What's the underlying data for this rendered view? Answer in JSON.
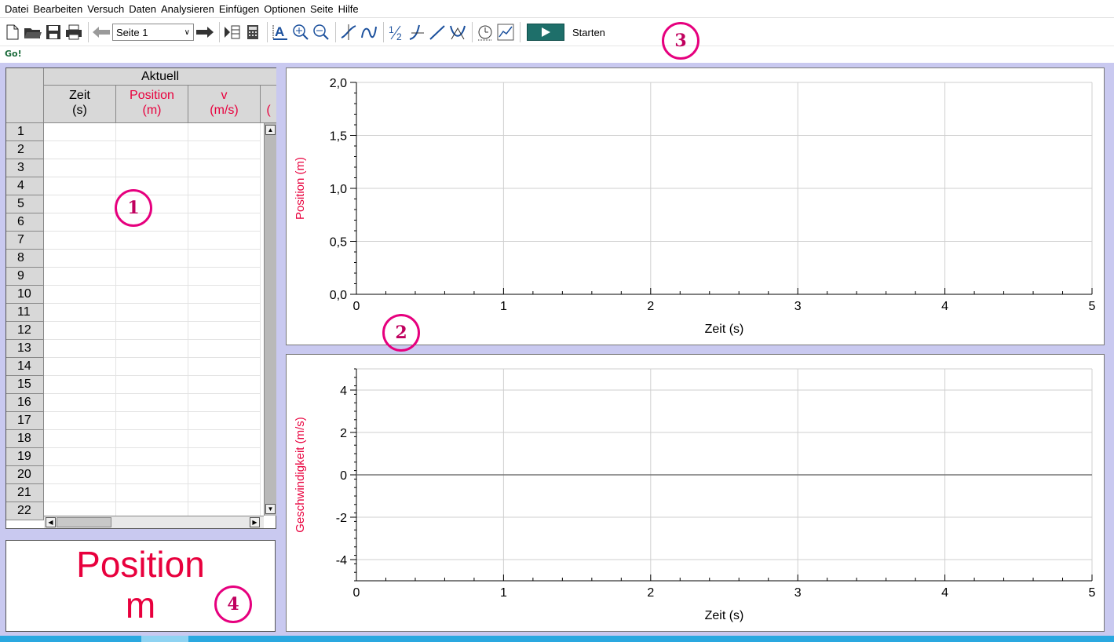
{
  "menu": [
    "Datei",
    "Bearbeiten",
    "Versuch",
    "Daten",
    "Analysieren",
    "Einfügen",
    "Optionen",
    "Seite",
    "Hilfe"
  ],
  "toolbar": {
    "page_select": "Seite 1",
    "start_label": "Starten",
    "icons": [
      "new-file-icon",
      "open-folder-icon",
      "save-icon",
      "print-icon",
      "back-arrow-icon",
      "forward-arrow-icon",
      "next-page-icon",
      "calculator-icon",
      "autoscale-icon",
      "zoom-in-icon",
      "zoom-out-icon",
      "examine-icon",
      "interpolate-icon",
      "half-fraction-icon",
      "tangent-icon",
      "linear-fit-icon",
      "curve-fit-icon",
      "stopwatch-icon",
      "graph-options-icon",
      "play-icon"
    ]
  },
  "go_logo": "Go!",
  "table": {
    "group_header": "Aktuell",
    "columns": [
      {
        "name": "Zeit",
        "unit": "(s)",
        "color": "#000000"
      },
      {
        "name": "Position",
        "unit": "(m)",
        "color": "#e8003d"
      },
      {
        "name": "v",
        "unit": "(m/s)",
        "color": "#e8003d"
      }
    ],
    "partial_column": "(",
    "rows": [
      "1",
      "2",
      "3",
      "4",
      "5",
      "6",
      "7",
      "8",
      "9",
      "10",
      "11",
      "12",
      "13",
      "14",
      "15",
      "16",
      "17",
      "18",
      "19",
      "20",
      "21",
      "22"
    ]
  },
  "meter": {
    "label": "Position",
    "unit": "m",
    "color": "#e8003d"
  },
  "callouts": [
    "1",
    "2",
    "3",
    "4"
  ],
  "chart_data": [
    {
      "type": "line",
      "title": "",
      "xlabel": "Zeit (s)",
      "ylabel": "Position (m)",
      "xlim": [
        0,
        5
      ],
      "ylim": [
        0,
        2.0
      ],
      "x_ticks": [
        "0",
        "1",
        "2",
        "3",
        "4",
        "5"
      ],
      "y_ticks": [
        "0,0",
        "0,5",
        "1,0",
        "1,5",
        "2,0"
      ],
      "grid": true,
      "series": []
    },
    {
      "type": "line",
      "title": "",
      "xlabel": "Zeit (s)",
      "ylabel": "Geschwindigkeit (m/s)",
      "xlim": [
        0,
        5
      ],
      "ylim": [
        -5,
        5
      ],
      "x_ticks": [
        "0",
        "1",
        "2",
        "3",
        "4",
        "5"
      ],
      "y_ticks": [
        "4",
        "2",
        "0",
        "-2",
        "-4"
      ],
      "grid": true,
      "series": []
    }
  ]
}
